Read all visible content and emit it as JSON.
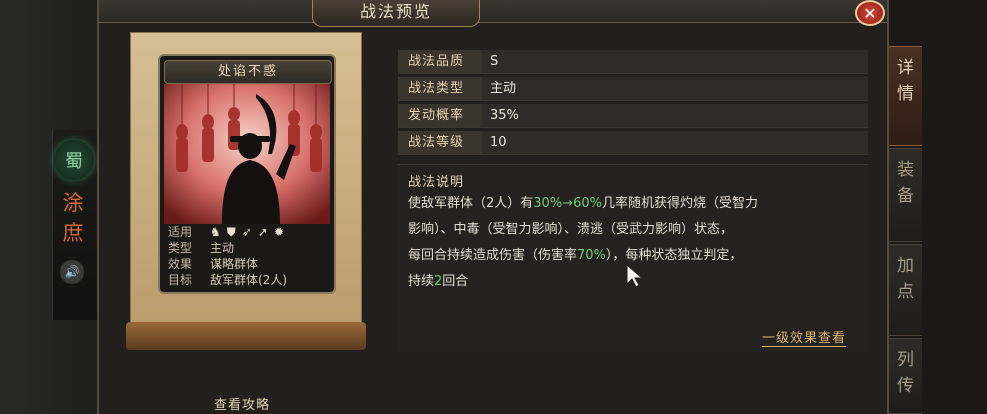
{
  "title": "战法预览",
  "sidebar": {
    "general_name_chars": [
      "涂",
      "庶"
    ],
    "faction_mark": "蜀"
  },
  "side_tabs": [
    {
      "label": "详情",
      "active": true
    },
    {
      "label": "装备",
      "active": false
    },
    {
      "label": "加点",
      "active": false
    },
    {
      "label": "列传",
      "active": false
    }
  ],
  "card": {
    "name": "处谄不惑",
    "usable_label": "适用",
    "usable_icons": [
      "cavalry-icon",
      "shield-icon",
      "bow-icon",
      "spear-icon",
      "siege-icon"
    ],
    "type_label": "类型",
    "type_value": "主动",
    "effect_label": "效果",
    "effect_value": "谋略群体",
    "target_label": "目标",
    "target_value": "敌军群体(2人)"
  },
  "details": {
    "quality_label": "战法品质",
    "quality_value": "S",
    "type_label": "战法类型",
    "type_value": "主动",
    "rate_label": "发动概率",
    "rate_value": "35%",
    "level_label": "战法等级",
    "level_value": "10"
  },
  "description": {
    "title": "战法说明",
    "line1_a": "使敌军群体（2人）有",
    "line1_hl": "30%→60%",
    "line1_b": "几率随机获得灼烧（受智力",
    "line2": "影响）、中毒（受智力影响）、溃逃（受武力影响）状态，",
    "line3_a": "每回合持续造成伤害（伤害率",
    "line3_hl": "70%",
    "line3_b": "），每种状态独立判定，",
    "line4_a": "持续",
    "line4_hl": "2",
    "line4_b": "回合"
  },
  "links": {
    "effect_link": "一级效果查看",
    "guide_link": "查看攻略"
  },
  "colors": {
    "highlight": "#6cc87a",
    "accent_gold": "#d9b574",
    "close_red": "#d44a3a"
  }
}
